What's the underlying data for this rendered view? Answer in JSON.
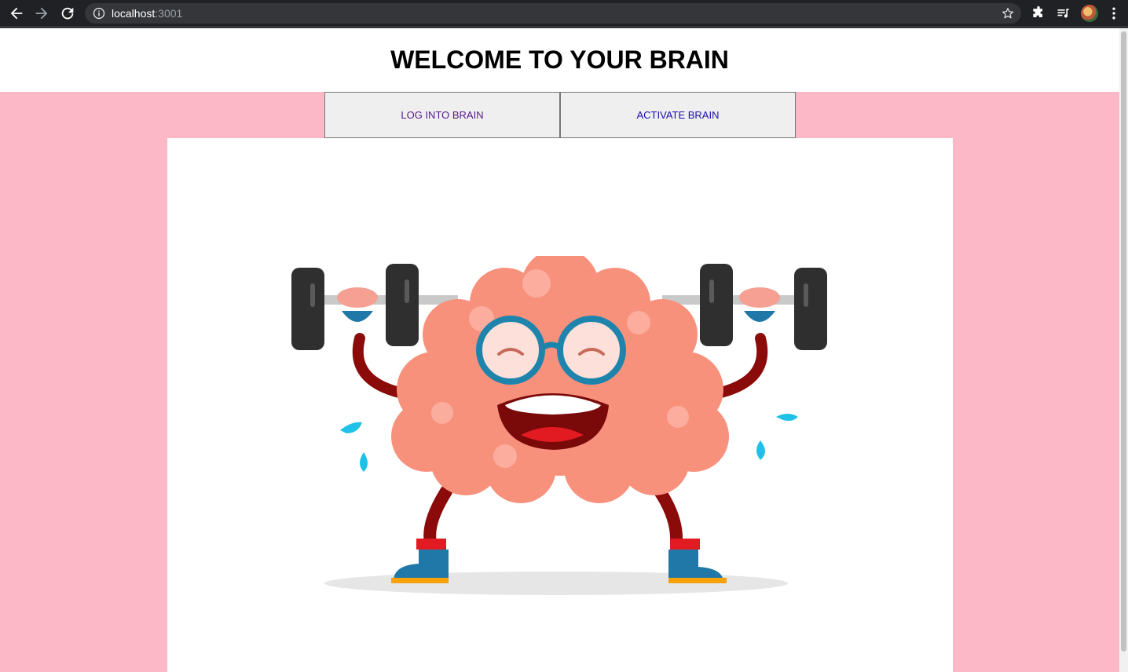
{
  "browser": {
    "url_host": "localhost",
    "url_port": ":3001"
  },
  "page": {
    "title": "WELCOME TO YOUR BRAIN",
    "buttons": {
      "login": "LOG INTO BRAIN",
      "activate": "ACTIVATE BRAIN"
    },
    "image": {
      "description_icon": "brain-lifting-dumbbells-illustration"
    }
  },
  "colors": {
    "background_pink": "#fdb8c8",
    "button_bg": "#efefef",
    "visited_link": "#551a8b",
    "link": "#1a0dab"
  }
}
